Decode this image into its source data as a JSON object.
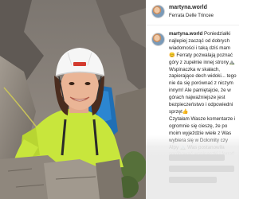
{
  "post": {
    "username": "martyna.world",
    "location": "Ferrata Delle Trincee",
    "caption_username": "martyna.world",
    "caption_text": " Poniedziałki najlepiej zacząć od dobrych wiadomości i taką dziś mam 😊 Ferraty pozwalają poznać góry z zupełnie innej strony⛰️ Wspinaczka w skałach, zapierające dech widoki... tego nie da się porównać z niczym innym! Ale pamiętajcie, że w górach najważniejsze jest bezpieczeństwo i odpowiedni sprzęt👍\nCzytałam Wasze komentarze i ogromnie się cieszę, że po moim wyjeździe wiele z Was wybiera się w Dolomity czy Alpy 🏔️ Was postanowiła spróbować wspinaczki i ferrat! Zarazanie pasją sprawia mi ogromną radość!❤️\nChętnie dam Wam do testowania moje"
  },
  "colors": {
    "accent_helmet": "#ffffff",
    "jacket": "#c8e63c",
    "rock": "#8a8279"
  }
}
